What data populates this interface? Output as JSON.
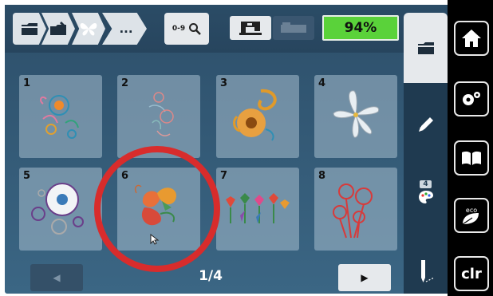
{
  "topbar": {
    "breadcrumb": [
      {
        "icon": "folder-icon"
      },
      {
        "icon": "folder-embroidery-icon"
      },
      {
        "icon": "butterfly-icon"
      },
      {
        "label": "..."
      }
    ],
    "search": {
      "label": "0-9",
      "icon": "search-icon"
    },
    "machine_icon": "embroidery-machine-icon",
    "module_icon": "embroidery-module-icon",
    "battery": {
      "value": "94%",
      "level": 0.94,
      "color": "#5ad23a"
    },
    "folder_tab_icon": "folder-icon"
  },
  "designs": [
    {
      "number": "1",
      "name": "blue-floral-spray"
    },
    {
      "number": "2",
      "name": "light-floral-sketch"
    },
    {
      "number": "3",
      "name": "orange-daisy-paisley"
    },
    {
      "number": "4",
      "name": "white-lily"
    },
    {
      "number": "5",
      "name": "white-doily-flower"
    },
    {
      "number": "6",
      "name": "red-poppy-hummingbird"
    },
    {
      "number": "7",
      "name": "folk-flowers-row"
    },
    {
      "number": "8",
      "name": "red-poppies-outline"
    }
  ],
  "highlight": {
    "selected_design": "6",
    "color": "#d82c2c"
  },
  "pagination": {
    "current": "1/4"
  },
  "side_panel": {
    "edit_icon": "pencil-icon",
    "color_count": "4",
    "color_icon": "color-palette-icon",
    "stitch_icon": "needle-icon"
  },
  "hardware_buttons": [
    {
      "icon": "home-icon"
    },
    {
      "icon": "settings-icon"
    },
    {
      "icon": "tutorial-book-icon"
    },
    {
      "icon": "eco-icon",
      "label": "eco"
    },
    {
      "label": "clr"
    }
  ]
}
